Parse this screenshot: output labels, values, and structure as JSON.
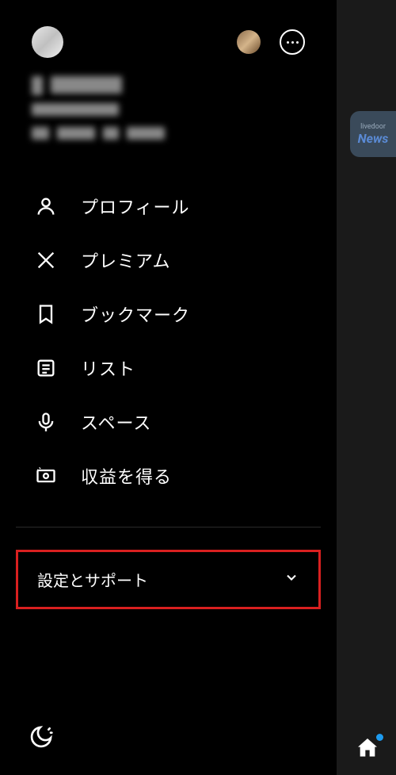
{
  "nav": {
    "profile": "プロフィール",
    "premium": "プレミアム",
    "bookmarks": "ブックマーク",
    "lists": "リスト",
    "spaces": "スペース",
    "monetization": "収益を得る"
  },
  "settings_support": "設定とサポート",
  "news": {
    "line1": "livedoor",
    "line2": "News"
  }
}
